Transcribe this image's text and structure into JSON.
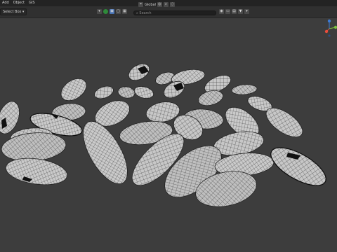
{
  "menubar": {
    "items": [
      "Add",
      "Object",
      "GIS"
    ]
  },
  "toolbar": {
    "select_box": "Select Box ▾"
  },
  "orientation": {
    "label": "Global"
  },
  "search": {
    "placeholder": "Search"
  },
  "colors": {
    "viewport_bg": "#3d3d3d",
    "mesh_fill": "#c9c9c9",
    "wire": "#2b2b2b",
    "selected_outline": "#0a0a0a",
    "gizmo_x": "#e74c3c",
    "gizmo_y": "#7fbf3f",
    "gizmo_z": "#3c7bd6"
  },
  "icons": {
    "header_left": [
      "green-dot-icon",
      "cube-icon",
      "select-icon",
      "grid-icon"
    ],
    "header_right": [
      "eye-icon",
      "overlay-icon",
      "filter-icon",
      "funnel-icon"
    ],
    "orient_tools": [
      "pivot-icon",
      "snap-icon",
      "proportional-icon"
    ]
  }
}
